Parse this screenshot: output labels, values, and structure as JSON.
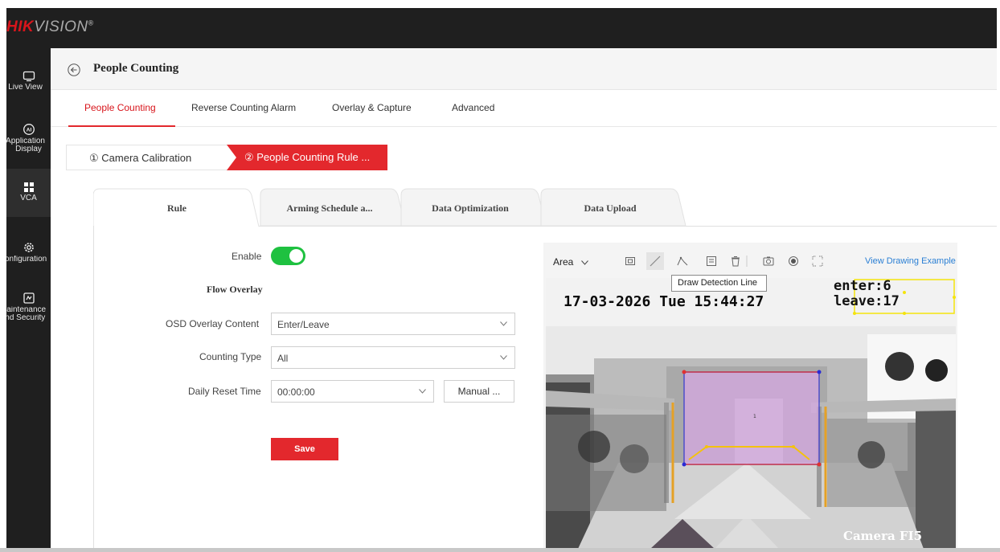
{
  "brand": {
    "name_red": "HIK",
    "name_gray": "VISION",
    "mark": "®"
  },
  "sidebar": {
    "items": [
      {
        "icon": "monitor-icon",
        "label1": "Live View",
        "label2": ""
      },
      {
        "icon": "ai-icon",
        "label1": "Application",
        "label2": "Display"
      },
      {
        "icon": "vca-grid-icon",
        "label1": "VCA",
        "label2": ""
      },
      {
        "icon": "gear-icon",
        "label1": "Configuration",
        "label2": ""
      },
      {
        "icon": "maintenance-icon",
        "label1": "Maintenance",
        "label2": "and Security"
      }
    ]
  },
  "page": {
    "title": "People Counting"
  },
  "tabs": [
    "People Counting",
    "Reverse Counting Alarm",
    "Overlay & Capture",
    "Advanced"
  ],
  "steps": {
    "step1": "① Camera Calibration",
    "step2": "② People Counting Rule ..."
  },
  "subtabs": [
    "Rule",
    "Arming Schedule a...",
    "Data Optimization",
    "Data Upload"
  ],
  "form": {
    "enable_label": "Enable",
    "enable_on": true,
    "flow_overlay_title": "Flow Overlay",
    "osd_label": "OSD Overlay Content",
    "osd_value": "Enter/Leave",
    "counting_type_label": "Counting Type",
    "counting_type_value": "All",
    "reset_label": "Daily Reset Time",
    "reset_value": "00:00:00",
    "manual_button": "Manual ...",
    "save_button": "Save"
  },
  "video_toolbar": {
    "area_label": "Area",
    "view_example": "View Drawing Example",
    "tooltip": "Draw Detection Line",
    "icons": [
      "draw-area-icon",
      "draw-line-icon",
      "draw-polyline-icon",
      "edit-icon",
      "delete-icon",
      "snapshot-icon",
      "record-icon",
      "fullscreen-icon"
    ]
  },
  "video": {
    "timestamp": "17-03-2026 Tue 15:44:27",
    "enter": "enter:6",
    "leave": "leave:17",
    "camera_name": "Camera FI5"
  },
  "colors": {
    "accent": "#e3282d",
    "toggle_on": "#1ec140",
    "link": "#2a7fd4"
  }
}
